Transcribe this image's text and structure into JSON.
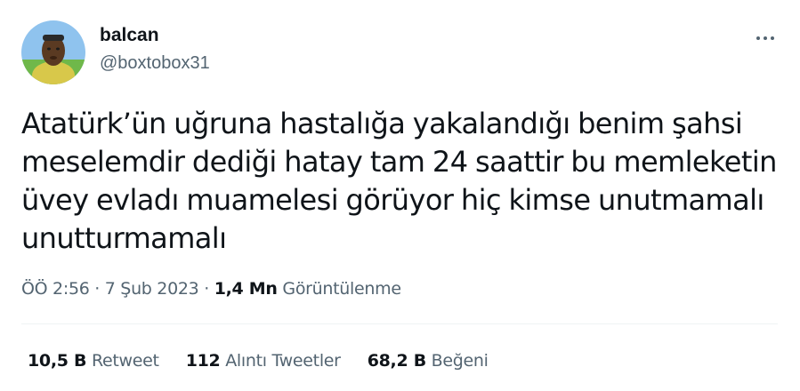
{
  "author": {
    "display_name": "balcan",
    "handle": "@boxtobox31",
    "avatar_icon": "avatar-image"
  },
  "more_icon": "more-horizontal-icon",
  "tweet": {
    "text": "Atatürk’ün uğruna hastalığa yakalandığı benim şahsi meselemdir dediği hatay tam 24 saattir bu memleketin üvey evladı muamelesi görüyor hiç kimse unutmamalı unutturmamalı"
  },
  "meta": {
    "time": "ÖÖ 2:56",
    "separator": "·",
    "date": "7 Şub 2023",
    "views_count": "1,4 Mn",
    "views_label": "Görüntülenme"
  },
  "stats": {
    "retweets_count": "10,5 B",
    "retweets_label": "Retweet",
    "quotes_count": "112",
    "quotes_label": "Alıntı Tweetler",
    "likes_count": "68,2 B",
    "likes_label": "Beğeni"
  },
  "colors": {
    "primary_text": "#0f1419",
    "secondary_text": "#536471",
    "divider": "#eff3f4"
  }
}
